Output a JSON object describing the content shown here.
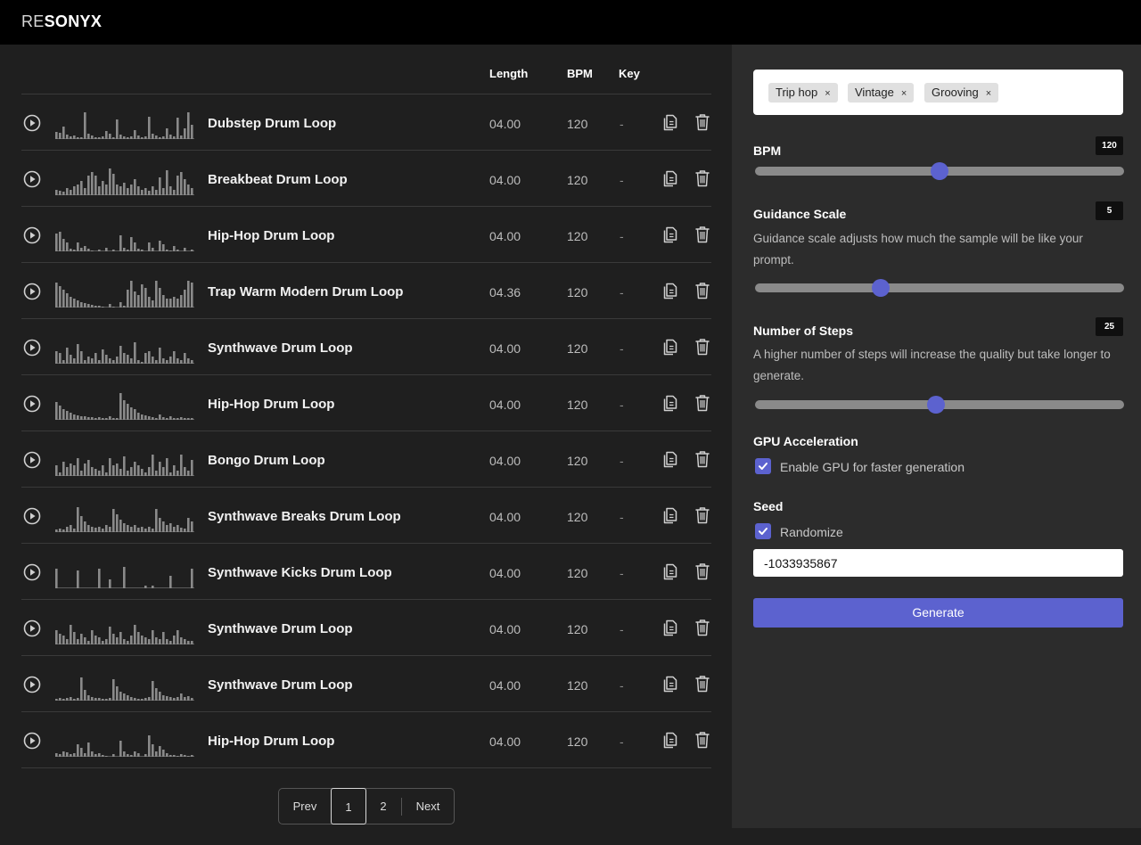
{
  "app": {
    "logo_prefix": "RE",
    "logo_rest": "SONYX"
  },
  "table": {
    "headers": {
      "length": "Length",
      "bpm": "BPM",
      "key": "Key"
    },
    "rows": [
      {
        "name": "Dubstep Drum Loop",
        "length": "04.00",
        "bpm": "120",
        "key": "-"
      },
      {
        "name": "Breakbeat Drum Loop",
        "length": "04.00",
        "bpm": "120",
        "key": "-"
      },
      {
        "name": "Hip-Hop Drum Loop",
        "length": "04.00",
        "bpm": "120",
        "key": "-"
      },
      {
        "name": "Trap Warm Modern Drum Loop",
        "length": "04.36",
        "bpm": "120",
        "key": "-"
      },
      {
        "name": "Synthwave Drum Loop",
        "length": "04.00",
        "bpm": "120",
        "key": "-"
      },
      {
        "name": "Hip-Hop Drum Loop",
        "length": "04.00",
        "bpm": "120",
        "key": "-"
      },
      {
        "name": "Bongo Drum Loop",
        "length": "04.00",
        "bpm": "120",
        "key": "-"
      },
      {
        "name": "Synthwave Breaks Drum Loop",
        "length": "04.00",
        "bpm": "120",
        "key": "-"
      },
      {
        "name": "Synthwave Kicks Drum Loop",
        "length": "04.00",
        "bpm": "120",
        "key": "-"
      },
      {
        "name": "Synthwave Drum Loop",
        "length": "04.00",
        "bpm": "120",
        "key": "-"
      },
      {
        "name": "Synthwave Drum Loop",
        "length": "04.00",
        "bpm": "120",
        "key": "-"
      },
      {
        "name": "Hip-Hop Drum Loop",
        "length": "04.00",
        "bpm": "120",
        "key": "-"
      }
    ]
  },
  "pagination": {
    "prev": "Prev",
    "pages": [
      "1",
      "2"
    ],
    "current": "1",
    "next": "Next"
  },
  "settings": {
    "tags": [
      "Trip hop",
      "Vintage",
      "Grooving"
    ],
    "tag_remove": "×",
    "bpm": {
      "label": "BPM",
      "value": "120",
      "slider_fraction": 0.5
    },
    "guidance": {
      "label": "Guidance Scale",
      "value": "5",
      "description": "Guidance scale adjusts how much the sample will be like your prompt.",
      "slider_fraction": 0.34
    },
    "steps": {
      "label": "Number of Steps",
      "value": "25",
      "description": "A higher number of steps will increase the quality but take longer to generate.",
      "slider_fraction": 0.49
    },
    "gpu": {
      "label": "GPU Acceleration",
      "checkbox_label": "Enable GPU for faster generation",
      "checked": true
    },
    "seed": {
      "label": "Seed",
      "randomize_label": "Randomize",
      "randomize_checked": true,
      "value": "-1033935867"
    },
    "generate_label": "Generate"
  },
  "colors": {
    "accent": "#5c62cf",
    "background": "#1f1f1f",
    "panel": "#2c2c2c",
    "topbar": "#000000"
  }
}
